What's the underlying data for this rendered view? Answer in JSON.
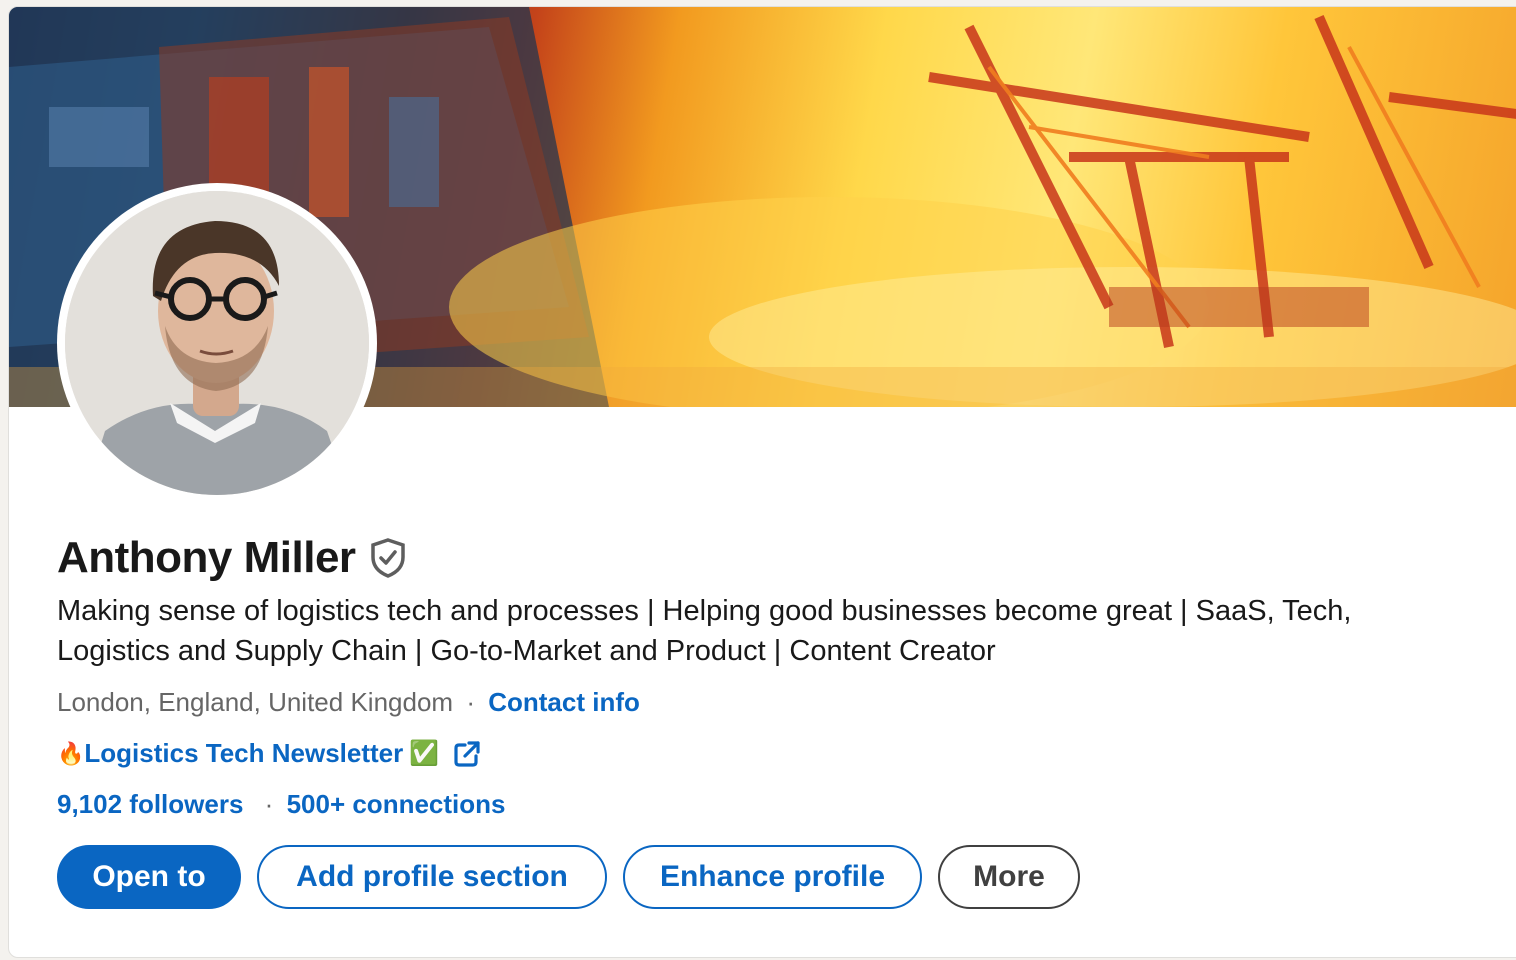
{
  "profile": {
    "name": "Anthony Miller",
    "headline_line1": "Making sense of logistics tech and processes | Helping good businesses become great | SaaS, Tech,",
    "headline_line2": "Logistics and Supply Chain | Go-to-Market and Product | Content Creator",
    "location": "London, England, United Kingdom",
    "separator": "·",
    "contact_info": "Contact info",
    "newsletter_prefix": "🔥",
    "newsletter_title": "Logistics Tech Newsletter",
    "newsletter_check": "✅",
    "followers": "9,102 followers",
    "connections": "500+ connections"
  },
  "actions": {
    "open_to": "Open to",
    "add_section": "Add profile section",
    "enhance": "Enhance profile",
    "more": "More"
  },
  "colors": {
    "accent": "#0a66c2",
    "text": "#191919",
    "muted": "#666666"
  },
  "icons": {
    "verified": "shield-check-icon",
    "external_link": "external-link-icon"
  }
}
